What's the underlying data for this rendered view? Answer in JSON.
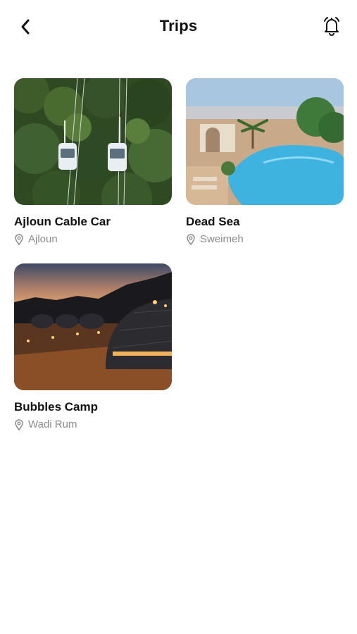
{
  "header": {
    "title": "Trips",
    "back_icon": "chevron-left-icon",
    "notification_icon": "bell-icon"
  },
  "trips": [
    {
      "name": "Ajloun Cable Car",
      "location": "Ajloun"
    },
    {
      "name": "Dead Sea",
      "location": "Sweimeh"
    },
    {
      "name": "Bubbles Camp",
      "location": "Wadi Rum"
    }
  ],
  "colors": {
    "text_primary": "#111111",
    "text_secondary": "#8a8a8a",
    "background": "#ffffff"
  }
}
